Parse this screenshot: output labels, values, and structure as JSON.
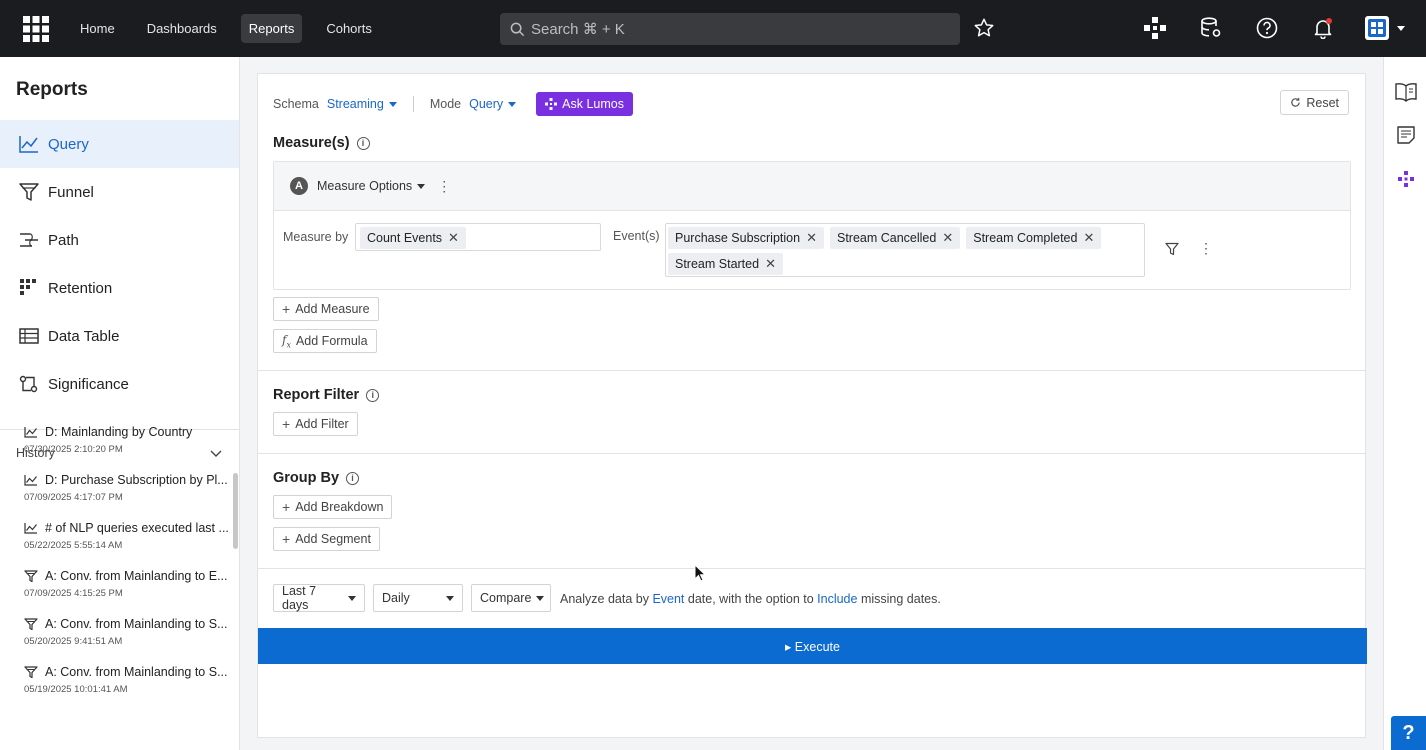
{
  "topnav": {
    "links": [
      "Home",
      "Dashboards",
      "Reports",
      "Cohorts"
    ],
    "search_placeholder": "Search ⌘ + K"
  },
  "sidebar": {
    "title": "Reports",
    "items": [
      "Query",
      "Funnel",
      "Path",
      "Retention",
      "Data Table",
      "Significance"
    ],
    "history_label": "History",
    "history": [
      {
        "title": "D: Mainlanding by Country",
        "date": "07/30/2025 2:10:20 PM",
        "icon": "line-chart-icon"
      },
      {
        "title": "D: Purchase Subscription by Pl...",
        "date": "07/09/2025 4:17:07 PM",
        "icon": "line-chart-icon"
      },
      {
        "title": "# of NLP queries executed last ...",
        "date": "05/22/2025 5:55:14 AM",
        "icon": "line-chart-icon"
      },
      {
        "title": "A: Conv. from Mainlanding to E...",
        "date": "07/09/2025 4:15:25 PM",
        "icon": "funnel-icon"
      },
      {
        "title": "A: Conv. from Mainlanding to S...",
        "date": "05/20/2025 9:41:51 AM",
        "icon": "funnel-icon"
      },
      {
        "title": "A: Conv. from Mainlanding to S...",
        "date": "05/19/2025 10:01:41 AM",
        "icon": "funnel-icon"
      }
    ]
  },
  "main": {
    "schema_label": "Schema",
    "schema_value": "Streaming",
    "mode_label": "Mode",
    "mode_value": "Query",
    "ask_lumos": "Ask Lumos",
    "reset": "Reset",
    "measures_title": "Measure(s)",
    "measure_letter": "A",
    "measure_options": "Measure Options",
    "measure_by_label": "Measure by",
    "measure_chip": "Count Events",
    "events_label": "Event(s)",
    "events": [
      "Purchase Subscription",
      "Stream Cancelled",
      "Stream Completed",
      "Stream Started"
    ],
    "add_measure": "Add Measure",
    "add_formula": "Add Formula",
    "report_filter_title": "Report Filter",
    "add_filter": "Add Filter",
    "group_by_title": "Group By",
    "add_breakdown": "Add Breakdown",
    "add_segment": "Add Segment",
    "date_range": "Last 7 days",
    "interval": "Daily",
    "compare": "Compare",
    "analyze_pre": "Analyze data by",
    "analyze_event": "Event",
    "analyze_mid": "date, with the option to",
    "analyze_include": "Include",
    "analyze_post": "missing dates.",
    "execute": "▸ Execute"
  },
  "colors": {
    "accent": "#1a67c9",
    "lumos": "#7a2fe0",
    "execute": "#0b6bd1",
    "topbar": "#1b1c1f"
  }
}
